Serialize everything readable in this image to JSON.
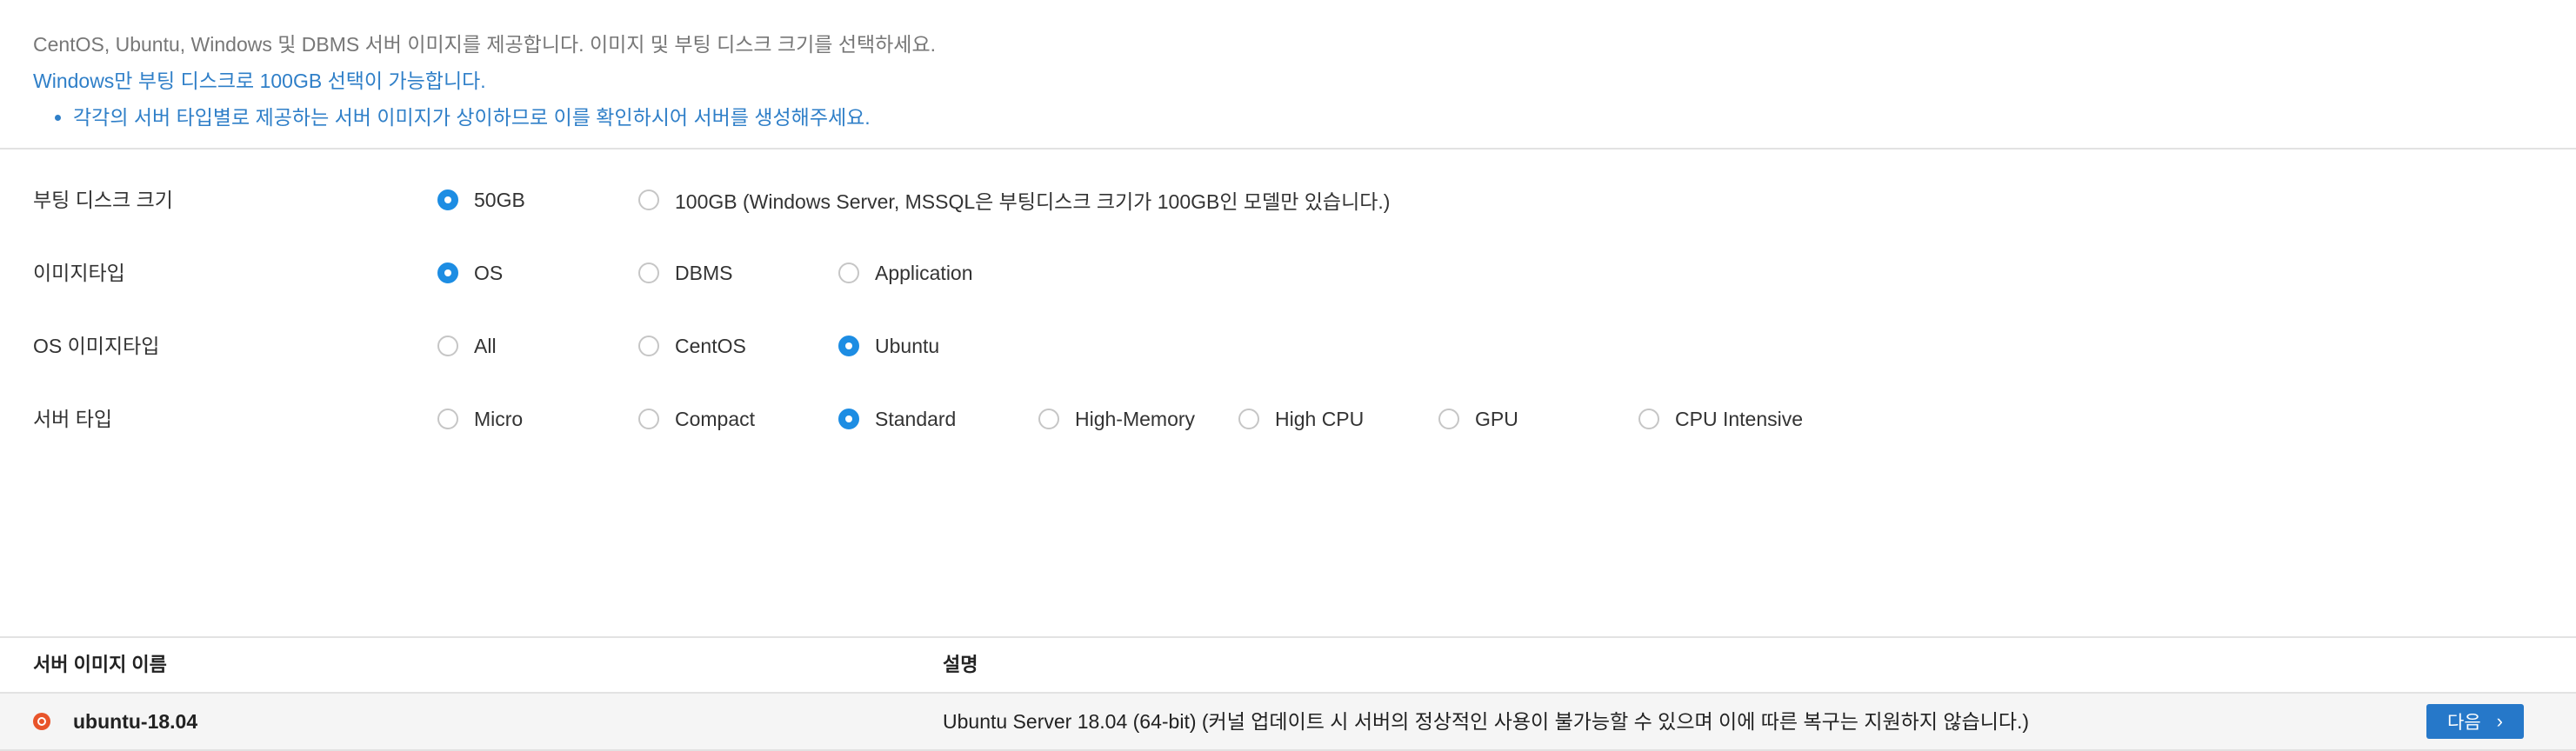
{
  "notice": {
    "line1": "CentOS, Ubuntu, Windows 및 DBMS 서버 이미지를 제공합니다. 이미지 및 부팅 디스크 크기를 선택하세요.",
    "line2": "Windows만 부팅 디스크로 100GB 선택이 가능합니다.",
    "bullet": "각각의 서버 타입별로 제공하는 서버 이미지가 상이하므로 이를 확인하시어 서버를 생성해주세요."
  },
  "options": {
    "boot_disk": {
      "label": "부팅 디스크 크기",
      "choices": [
        "50GB",
        "100GB (Windows Server, MSSQL은 부팅디스크 크기가 100GB인 모델만 있습니다.)"
      ],
      "selected": "50GB"
    },
    "image_type": {
      "label": "이미지타입",
      "choices": [
        "OS",
        "DBMS",
        "Application"
      ],
      "selected": "OS"
    },
    "os_image_type": {
      "label": "OS 이미지타입",
      "choices": [
        "All",
        "CentOS",
        "Ubuntu"
      ],
      "selected": "Ubuntu"
    },
    "server_type": {
      "label": "서버 타입",
      "choices": [
        "Micro",
        "Compact",
        "Standard",
        "High-Memory",
        "High CPU",
        "GPU",
        "CPU Intensive"
      ],
      "selected": "Standard"
    }
  },
  "table": {
    "headers": {
      "name": "서버 이미지 이름",
      "description": "설명"
    },
    "rows": [
      {
        "name": "ubuntu-18.04",
        "icon": "ubuntu-logo-icon",
        "description": "Ubuntu Server 18.04 (64-bit) (커널 업데이트 시 서버의 정상적인 사용이 불가능할 수 있으며 이에 따른 복구는 지원하지 않습니다.)",
        "action_label": "다음"
      }
    ]
  },
  "colors": {
    "accent": "#1d8de3",
    "button": "#2678c9",
    "notice_blue": "#2f7fc8"
  }
}
